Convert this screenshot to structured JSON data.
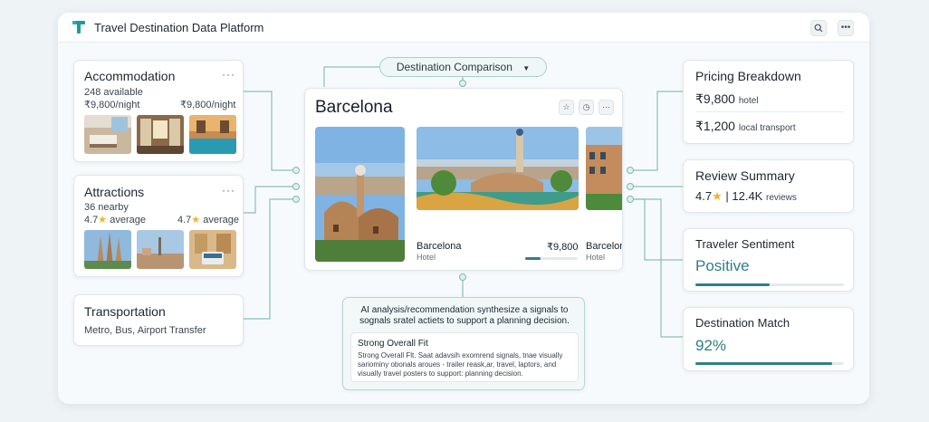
{
  "app": {
    "title": "Travel Destination Data Platform"
  },
  "selector": {
    "label": "Destination Comparison"
  },
  "accommodation": {
    "title": "Accommodation",
    "available": "248 available",
    "price_a": "₹9,800/night",
    "price_b": "₹9,800/night"
  },
  "attractions": {
    "title": "Attractions",
    "nearby": "36 nearby",
    "rating_a": "4.7",
    "rating_a_suffix": "average",
    "rating_b": "4.7",
    "rating_b_suffix": "average"
  },
  "transportation": {
    "title": "Transportation",
    "modes": "Metro, Bus, Airport Transfer"
  },
  "destination": {
    "name": "Barcelona",
    "card_name": "Barcelona",
    "card_type": "Hotel",
    "card_price": "₹9,800",
    "card_progress": 0.3,
    "card2_name": "Barcelon",
    "card2_type": "Hotel"
  },
  "ai": {
    "header": "AI analysis/recommendation synthesize a signals t̶o̶ signals sratel actiets to support a planning decision.",
    "header_line1": "AI analysis/recommendation synthesize a signals to",
    "header_line2": "sognals sratel actiets to support a planning decision.",
    "fit_title": "Strong Overall Fit",
    "fit_line1": "Strong Overall Flt. Saat adavsih exomrend signals, tnae visually",
    "fit_line2": "sariominy obonals aroues - trailer reask,ar, travel, laptors, and",
    "fit_line3": "visually travel posters to support: planning decision."
  },
  "pricing": {
    "title": "Pricing Breakdown",
    "hotel_value": "₹9,800",
    "hotel_label": "hotel",
    "transport_value": "₹1,200",
    "transport_label": "local transport"
  },
  "reviews": {
    "title": "Review Summary",
    "rating": "4.7",
    "separator": "|",
    "count": "12.4K",
    "count_label": "reviews"
  },
  "sentiment": {
    "title": "Traveler Sentiment",
    "value": "Positive",
    "level": 0.5
  },
  "match": {
    "title": "Destination Match",
    "value": "92%",
    "level": 0.92
  },
  "colors": {
    "accent": "#2f7f87",
    "star": "#f0b429",
    "node": "#7fb8b3"
  },
  "icons": {
    "logo": "logo-t-icon",
    "search": "search-icon",
    "more": "more-dots-icon",
    "star": "star-icon",
    "chevron": "chevron-down-icon"
  }
}
